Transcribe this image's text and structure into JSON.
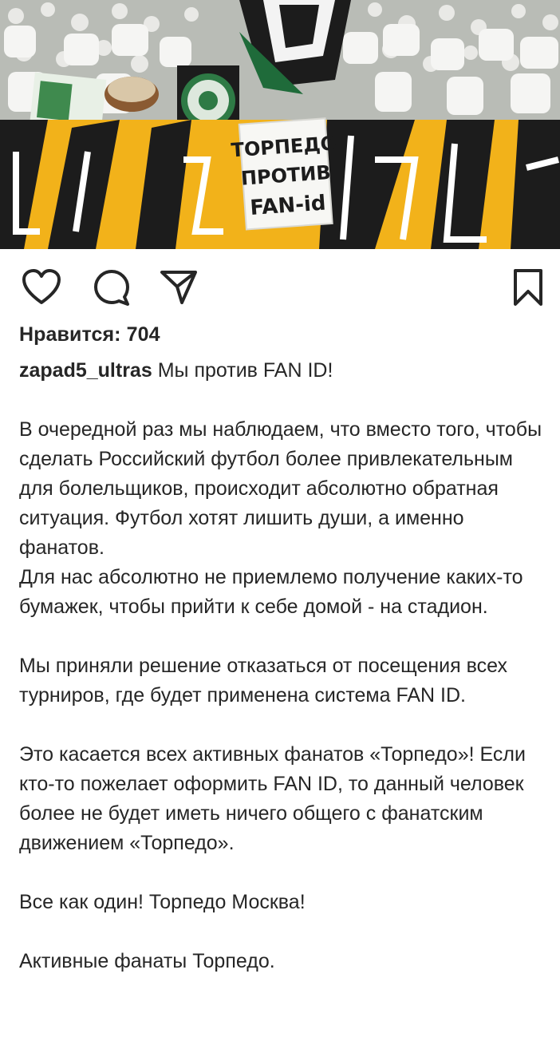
{
  "post": {
    "photo": {
      "description_icon": "photo-image",
      "banner_text": [
        "ТОРПЕДО",
        "ПРОТИВ",
        "FAN-id"
      ]
    },
    "actions": {
      "like_icon": "heart-icon",
      "comment_icon": "comment-icon",
      "share_icon": "paper-plane-icon",
      "save_icon": "bookmark-icon"
    },
    "likes_label": "Нравится: 704",
    "username": "zapad5_ultras",
    "caption_first": "Мы против FAN ID!",
    "paragraphs": [
      "В очередной раз мы наблюдаем, что вместо того, чтобы сделать Российский футбол более привлекательным для болельщиков, происходит абсолютно обратная ситуация. Футбол хотят лишить души, а именно фанатов.",
      "Для нас абсолютно не приемлемо получение каких-то бумажек, чтобы прийти к себе домой - на стадион.",
      "Мы приняли решение отказаться от посещения всех турниров, где будет применена система FAN ID.",
      "Это касается всех активных фанатов «Торпедо»! Если кто-то пожелает оформить FAN ID, то данный человек более не будет иметь ничего общего с фанатским движением «Торпедо».",
      "Все как один! Торпедо Москва!",
      "Активные фанаты Торпедо."
    ]
  },
  "colors": {
    "text": "#262626",
    "banner_yellow": "#f2b21a",
    "banner_black": "#1c1c1c",
    "flag_green": "#1f6b3a"
  }
}
